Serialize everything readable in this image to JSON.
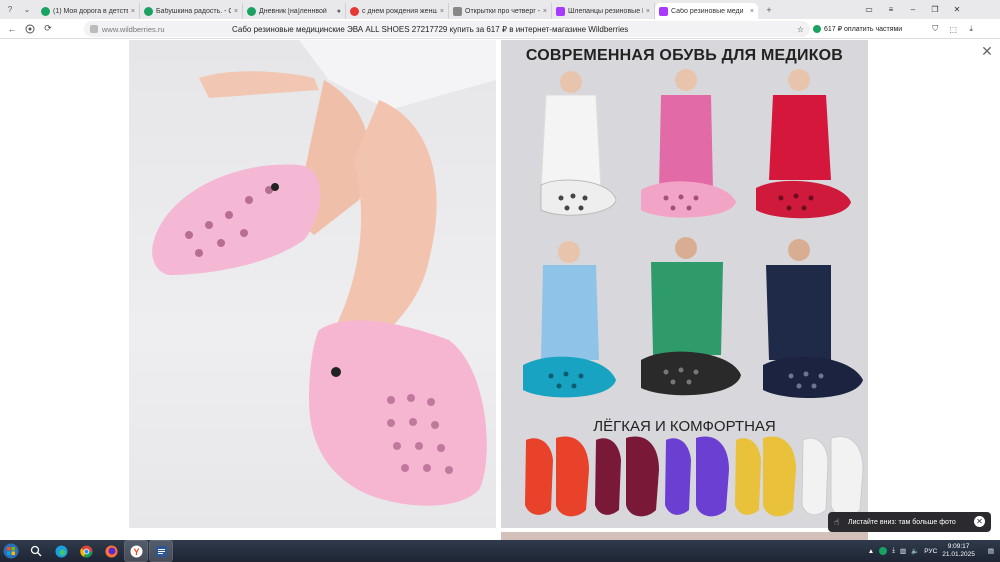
{
  "browser": {
    "tab_menu": "?",
    "tab_list": "⌄",
    "tabs": [
      {
        "title": "(1) Моя дорога в детство",
        "color": "#1aa260",
        "close": "×"
      },
      {
        "title": "Бабушкина радость. - Ст",
        "color": "#1aa260",
        "close": "×"
      },
      {
        "title": "Дневник [на]леннвой",
        "color": "#1aa260",
        "close": "●"
      },
      {
        "title": "с днем рождения женщи",
        "color": "#e53935",
        "close": "×"
      },
      {
        "title": "Открытки про четверг - т",
        "color": "#888888",
        "close": "×"
      },
      {
        "title": "Шлепанцы резиновые Ш",
        "color": "#a73afd",
        "close": "×"
      },
      {
        "title": "Сабо резиновые меди",
        "color": "#a73afd",
        "close": "×",
        "active": true
      }
    ],
    "new_tab": "+",
    "window_controls": {
      "tabs": "▭",
      "menu": "≡",
      "minimize": "–",
      "maximize": "❐",
      "close": "✕"
    }
  },
  "addressbar": {
    "back": "←",
    "reload": "⟳",
    "domain": "www.wildberries.ru",
    "page_title": "Сабо резиновые медицинские ЭВА ALL SHOES 27217729 купить за 617 ₽ в интернет-магазине Wildberries",
    "star": "☆",
    "promo": "617 ₽ оплатить частями",
    "extensions": [
      "⛉",
      "⬚",
      "⤓"
    ]
  },
  "content": {
    "close": "✕",
    "banner_title": "СОВРЕМЕННАЯ ОБУВЬ ДЛЯ МЕДИКОВ",
    "banner_subtitle": "ЛЁГКАЯ И КОМФОРТНАЯ",
    "toast": {
      "text": "Листайте вниз: там больше фото",
      "close": "✕"
    }
  },
  "taskbar": {
    "tray": {
      "lang": "РУС",
      "time": "9:09:17",
      "date": "21.01.2025"
    }
  },
  "colors": {
    "pink_clog": "#f5b8d4",
    "uniforms": [
      "#f4f4f4",
      "#e26aa7",
      "#d4173b",
      "#8fc3e8",
      "#2f9a6a",
      "#1f2a48"
    ],
    "clogs": [
      "#eeeeee",
      "#f2a4c6",
      "#d01a3b",
      "#19a3c2",
      "#2a2a2a",
      "#1c2340"
    ],
    "palette": [
      "#e8422b",
      "#7a1838",
      "#6b3fd1",
      "#e9c13a",
      "#f2f2f2"
    ]
  }
}
